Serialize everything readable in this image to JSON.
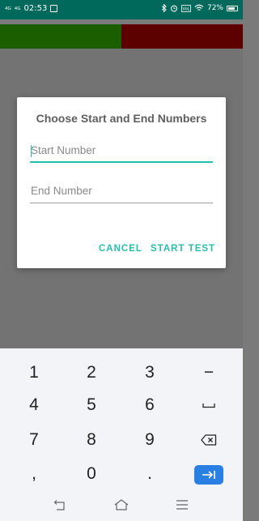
{
  "status_bar": {
    "network_a": "4G",
    "network_b": "4G",
    "time": "02:53",
    "battery": "72%",
    "icons": [
      "message-icon",
      "bluetooth-icon",
      "alarm-icon",
      "volte-icon",
      "wifi-icon",
      "battery-icon"
    ]
  },
  "app": {
    "colors": {
      "green_bar": "#1b5e00",
      "red_bar": "#5c0000",
      "status_bar": "#00695c"
    }
  },
  "dialog": {
    "title": "Choose Start and End Numbers",
    "start_field": {
      "placeholder": "Start Number",
      "value": ""
    },
    "end_field": {
      "placeholder": "End Number",
      "value": ""
    },
    "cancel_label": "CANCEL",
    "start_label": "START TEST",
    "accent": "#26bfae"
  },
  "keyboard": {
    "rows": [
      [
        "1",
        "2",
        "3",
        "−"
      ],
      [
        "4",
        "5",
        "6",
        "space"
      ],
      [
        "7",
        "8",
        "9",
        "backspace"
      ],
      [
        ",",
        "0",
        ".",
        "next"
      ]
    ],
    "k1": "1",
    "k2": "2",
    "k3": "3",
    "kminus": "−",
    "k4": "4",
    "k5": "5",
    "k6": "6",
    "k7": "7",
    "k8": "8",
    "k9": "9",
    "kcomma": ",",
    "k0": "0",
    "kdot": ".",
    "next_color": "#2a7fe2"
  },
  "nav": {
    "icons": [
      "back-icon",
      "home-icon",
      "menu-icon"
    ]
  }
}
